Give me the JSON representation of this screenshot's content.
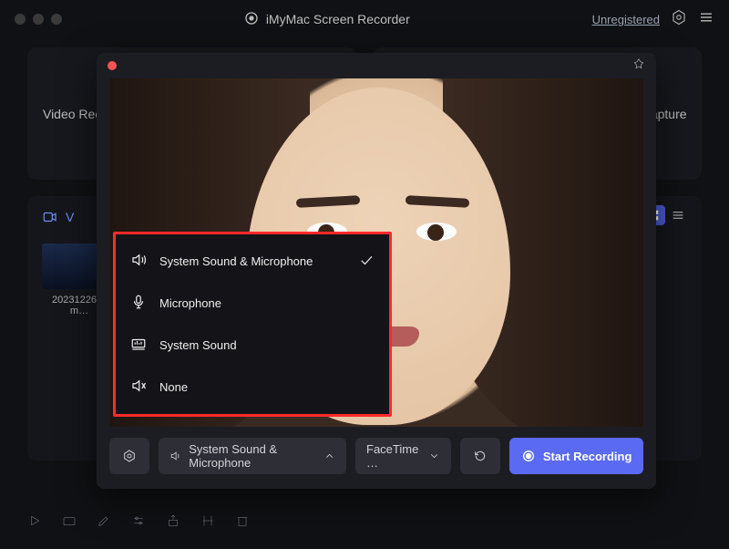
{
  "app": {
    "title": "iMyMac Screen Recorder",
    "registration_label": "Unregistered"
  },
  "tabs": {
    "left": "Video Recorder",
    "right": "Screen Capture"
  },
  "library": {
    "section_label": "V",
    "thumbnail_label": "20231226…\nm…"
  },
  "audio_menu": {
    "options": [
      {
        "label": "System Sound & Microphone",
        "icon": "speaker-waves-icon",
        "selected": true
      },
      {
        "label": "Microphone",
        "icon": "microphone-icon",
        "selected": false
      },
      {
        "label": "System Sound",
        "icon": "system-sound-icon",
        "selected": false
      },
      {
        "label": "None",
        "icon": "mute-icon",
        "selected": false
      }
    ]
  },
  "controls": {
    "audio_source_label": "System Sound & Microphone",
    "camera_label": "FaceTime …",
    "start_label": "Start Recording"
  }
}
